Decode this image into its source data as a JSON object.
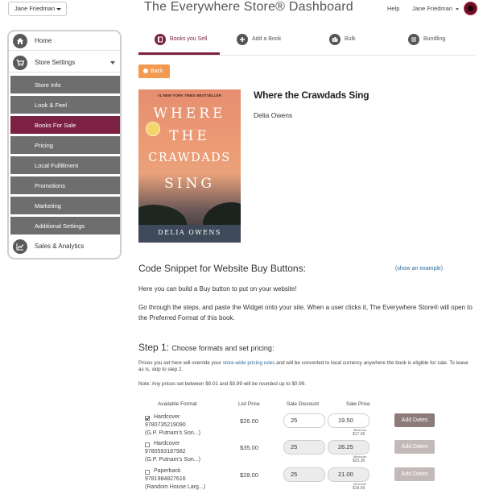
{
  "header": {
    "user_select": "Jane Friedman",
    "title": "The Everywhere Store® Dashboard",
    "help": "Help",
    "account": "Jane Friedman"
  },
  "sidebar": {
    "home": "Home",
    "store_settings": "Store Settings",
    "sub_items": [
      "Store Info",
      "Look & Feel",
      "Books For Sale",
      "Pricing",
      "Local Fulfillment",
      "Promotions",
      "Marketing",
      "Additional Settings"
    ],
    "active_sub": "Books For Sale",
    "sales_analytics": "Sales & Analytics"
  },
  "tabs": [
    {
      "label": "Books you Sell",
      "icon": "book-icon",
      "active": true
    },
    {
      "label": "Add a Book",
      "icon": "plus-icon",
      "active": false
    },
    {
      "label": "Bulk",
      "icon": "books-icon",
      "active": false
    },
    {
      "label": "Bundling",
      "icon": "list-icon",
      "active": false
    }
  ],
  "back_button": "Back",
  "book": {
    "title": "Where the Crawdads Sing",
    "author": "Delia Owens",
    "cover": {
      "badge": "#1 NEW YORK TIMES BESTSELLER",
      "title_lines": [
        "WHERE",
        "THE",
        "CRAWDADS",
        "SING"
      ],
      "author": "DELIA OWENS"
    }
  },
  "snippet": {
    "title": "Code Snippet for Website Buy Buttons:",
    "example_link": "(show an example)",
    "para1": "Here you can build a Buy button to put on your website!",
    "para2": "Go through the steps, and paste the Widget onto your site. When a user clicks it, The Everywhere Store® will open to the Preferred Format of this book."
  },
  "step1": {
    "title": "Step 1:",
    "subtitle": "Choose formats and set pricing:",
    "note1_pre": "Prices you set here will override your ",
    "note1_link": "store-wide pricing rules",
    "note1_post": " and will be converted to local currency anywhere the book is eligible for sale. To leave as is, skip to step 2.",
    "note2": "Note: Any prices set between $0.01 and $0.99 will be rounded up to $0.99.",
    "columns": {
      "format": "Available Format",
      "list": "List Price",
      "discount": "Sale Discount",
      "sale": "Sale Price"
    },
    "min_label": "Minimum",
    "add_dates_label": "Add Dates",
    "rows": [
      {
        "checked": true,
        "format": "Hardcover",
        "isbn": "9780735219090",
        "publisher": "(G.P. Putnam's Son...)",
        "list_price": "$26.00",
        "discount": "25",
        "sale_price": "19.50",
        "min": "$17.55"
      },
      {
        "checked": false,
        "format": "Hardcover",
        "isbn": "9780593187982",
        "publisher": "(G.P. Putnam's Son...)",
        "list_price": "$35.00",
        "discount": "25",
        "sale_price": "26.25",
        "min": "$23.36"
      },
      {
        "checked": false,
        "format": "Paperback",
        "isbn": "9781984827616",
        "publisher": "(Random House Larg...)",
        "list_price": "$28.00",
        "discount": "25",
        "sale_price": "21.00",
        "min": "$18.69"
      }
    ]
  },
  "colors": {
    "accent": "#7c2143",
    "orange": "#f39a52",
    "sidebar_gray": "#6e6e6e",
    "link": "#2a6b9c"
  }
}
